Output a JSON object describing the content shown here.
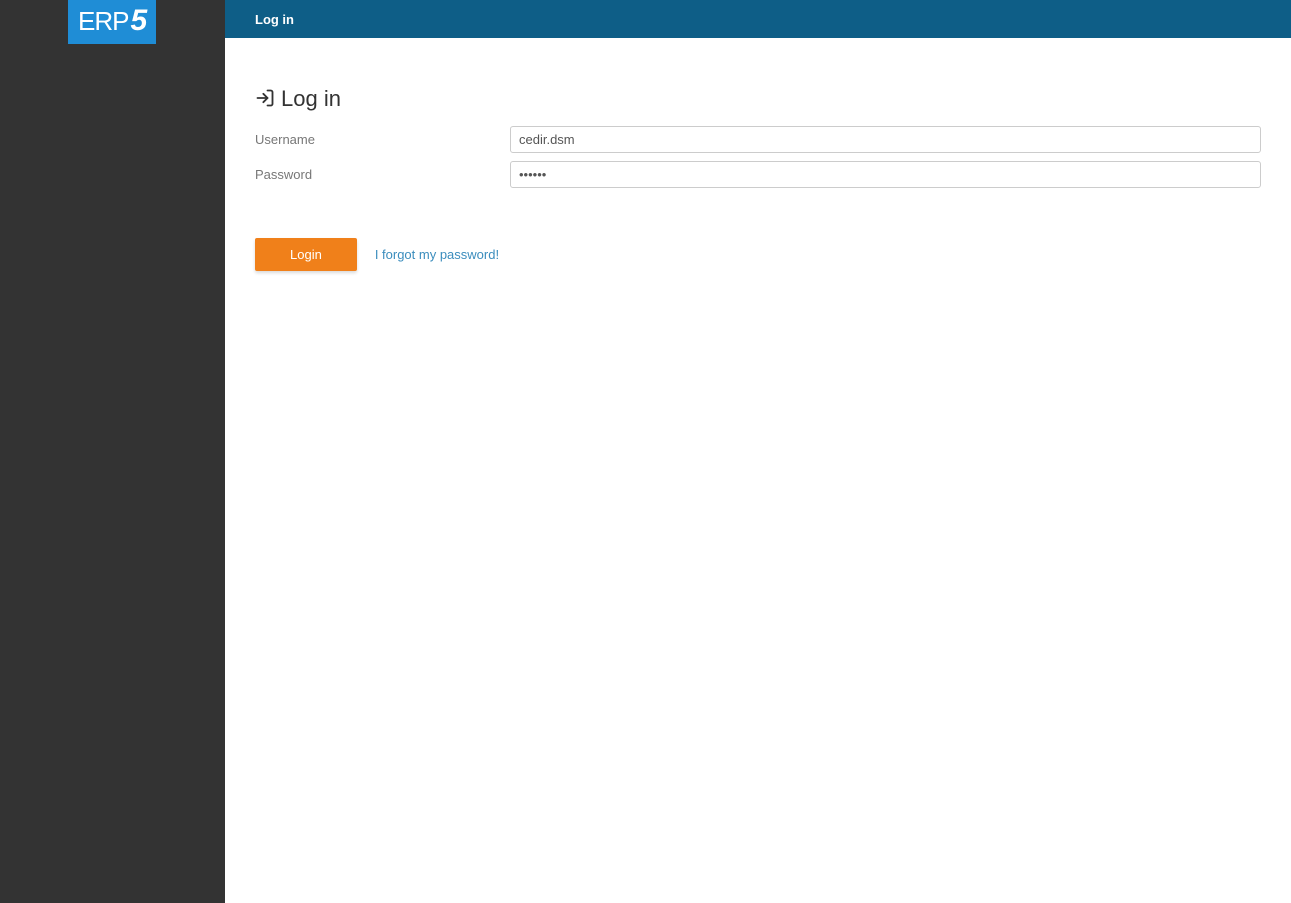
{
  "logo": {
    "text_main": "ERP",
    "text_suffix": "5"
  },
  "topbar": {
    "title": "Log in"
  },
  "page": {
    "heading": "Log in"
  },
  "form": {
    "username_label": "Username",
    "username_value": "cedir.dsm",
    "password_label": "Password",
    "password_value": "••••••"
  },
  "actions": {
    "login_button": "Login",
    "forgot_link": "I forgot my password!"
  }
}
